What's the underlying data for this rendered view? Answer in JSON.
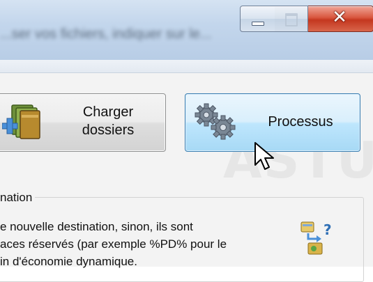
{
  "window": {
    "title": "...ser vos fichiers, indiquer sur le..."
  },
  "buttons": {
    "load_folders": {
      "line1": "Charger",
      "line2": "dossiers"
    },
    "process": {
      "label": "Processus"
    }
  },
  "destination_group": {
    "title": "nation",
    "lines": [
      "e nouvelle destination, sinon, ils sont",
      "aces réservés (par exemple %PD% pour le",
      "in d'économie dynamique."
    ]
  },
  "watermark": "ASTUCE",
  "colors": {
    "close_button": "#d24a2f",
    "process_button_hover": "#bee6fd",
    "titlebar": "#c3d6ec"
  },
  "icons": {
    "load_folders": "folder-with-plus-icon",
    "process": "gears-icon",
    "help": "path-variables-help-icon",
    "cursor": "mouse-pointer-icon"
  }
}
